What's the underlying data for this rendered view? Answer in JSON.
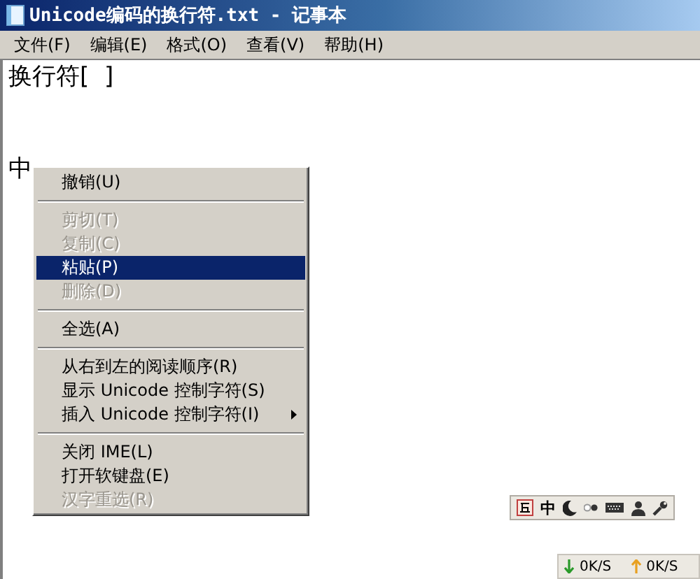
{
  "window": {
    "title": "Unicode编码的换行符.txt - 记事本"
  },
  "menu_bar": [
    {
      "label": "文件(F)"
    },
    {
      "label": "编辑(E)"
    },
    {
      "label": "格式(O)"
    },
    {
      "label": "查看(V)"
    },
    {
      "label": "帮助(H)"
    }
  ],
  "document": {
    "lines": [
      {
        "kind": "text",
        "text": "换行符[  ]"
      },
      {
        "kind": "blank"
      },
      {
        "kind": "blank"
      },
      {
        "kind": "text",
        "text": "中"
      }
    ]
  },
  "context_menu": {
    "items": [
      {
        "kind": "item",
        "label": "撤销(U)",
        "disabled": false,
        "selected": false,
        "submenu": false
      },
      {
        "kind": "separator"
      },
      {
        "kind": "item",
        "label": "剪切(T)",
        "disabled": true,
        "selected": false,
        "submenu": false
      },
      {
        "kind": "item",
        "label": "复制(C)",
        "disabled": true,
        "selected": false,
        "submenu": false
      },
      {
        "kind": "item",
        "label": "粘贴(P)",
        "disabled": false,
        "selected": true,
        "submenu": false
      },
      {
        "kind": "item",
        "label": "删除(D)",
        "disabled": true,
        "selected": false,
        "submenu": false
      },
      {
        "kind": "separator"
      },
      {
        "kind": "item",
        "label": "全选(A)",
        "disabled": false,
        "selected": false,
        "submenu": false
      },
      {
        "kind": "separator"
      },
      {
        "kind": "item",
        "label": "从右到左的阅读顺序(R)",
        "disabled": false,
        "selected": false,
        "submenu": false
      },
      {
        "kind": "item",
        "label": "显示 Unicode 控制字符(S)",
        "disabled": false,
        "selected": false,
        "submenu": false
      },
      {
        "kind": "item",
        "label": "插入 Unicode 控制字符(I)",
        "disabled": false,
        "selected": false,
        "submenu": true
      },
      {
        "kind": "separator"
      },
      {
        "kind": "item",
        "label": "关闭 IME(L)",
        "disabled": false,
        "selected": false,
        "submenu": false
      },
      {
        "kind": "item",
        "label": "打开软键盘(E)",
        "disabled": false,
        "selected": false,
        "submenu": false
      },
      {
        "kind": "item",
        "label": "汉字重选(R)",
        "disabled": true,
        "selected": false,
        "submenu": false
      }
    ]
  },
  "ime_bar": {
    "mode": "中"
  },
  "net_speed": {
    "download": "0K/S",
    "upload": "0K/S"
  }
}
